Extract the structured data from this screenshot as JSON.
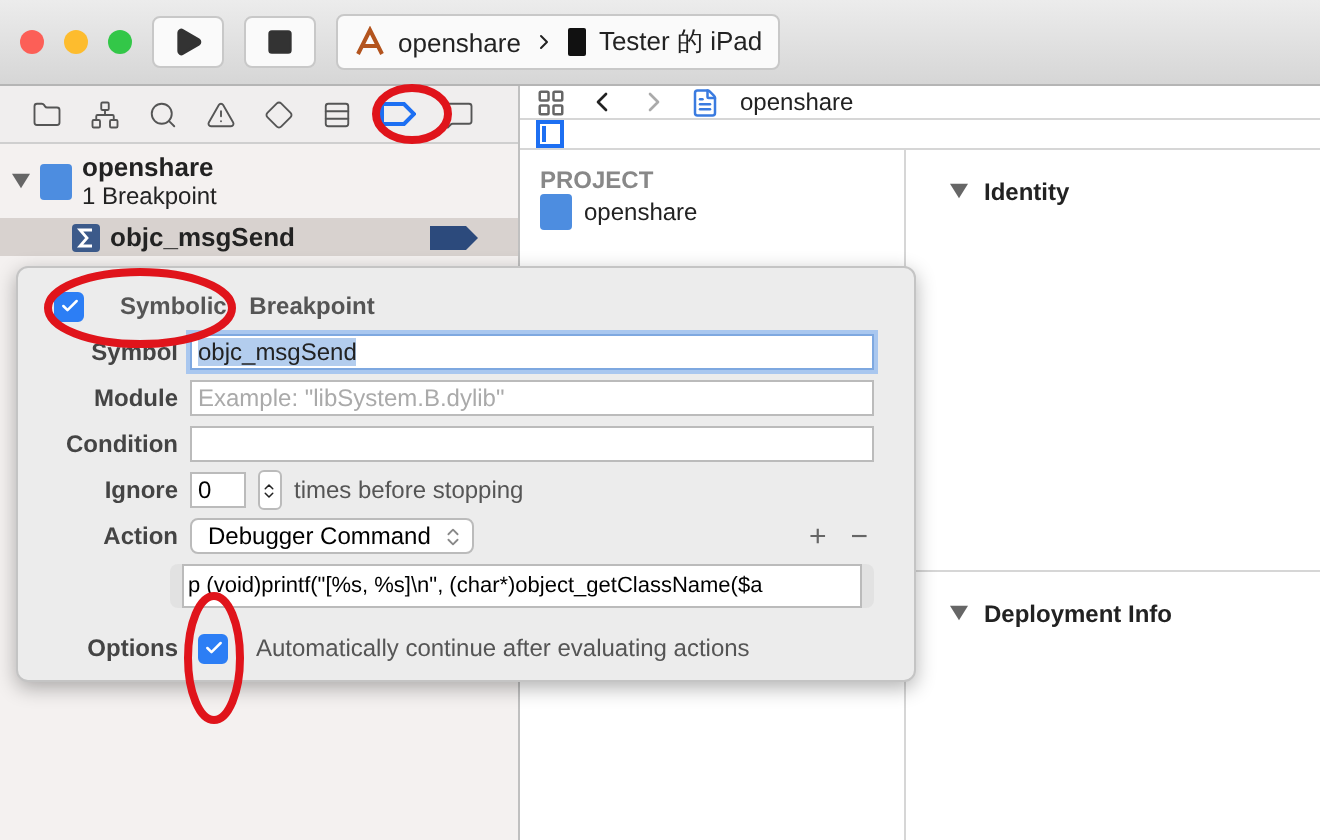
{
  "toolbar": {
    "project": "openshare",
    "device": "Tester 的 iPad"
  },
  "navigator_tabs": [
    {
      "kind": "folder",
      "selected": false
    },
    {
      "kind": "hierarchy",
      "selected": false
    },
    {
      "kind": "search",
      "selected": false
    },
    {
      "kind": "warning",
      "selected": false
    },
    {
      "kind": "test",
      "selected": false
    },
    {
      "kind": "debug",
      "selected": false
    },
    {
      "kind": "breakpoint",
      "selected": true
    },
    {
      "kind": "report",
      "selected": false
    }
  ],
  "tree": {
    "name": "openshare",
    "subtitle": "1 Breakpoint",
    "expanded": true,
    "children": [
      {
        "name": "objc_msgSend",
        "selected": true,
        "enabled": true
      }
    ]
  },
  "jump_bar": {
    "crumb": "openshare"
  },
  "project_list": {
    "heading": "PROJECT",
    "items": [
      "openshare"
    ]
  },
  "inspector": [
    {
      "title": "Identity",
      "expanded": true
    },
    {
      "title": "Deployment Info",
      "expanded": true
    }
  ],
  "popover": {
    "enabled": true,
    "title": "Symbolic Breakpoint",
    "fields": [
      {
        "label": "Symbol",
        "value": "objc_msgSend",
        "focused": true
      },
      {
        "label": "Module",
        "placeholder": "Example: \"libSystem.B.dylib\"",
        "focused": false
      },
      {
        "label": "Condition",
        "focused": false
      }
    ],
    "ignore": {
      "label": "Ignore",
      "value": "0",
      "suffix": "times before stopping"
    },
    "action": {
      "label": "Action",
      "value": "Debugger Command",
      "add": "+",
      "remove": "−",
      "command": "p (void)printf(\"[%s, %s]\\n\", (char*)object_getClassName($a"
    },
    "options": {
      "label": "Options",
      "checked": true,
      "text": "Automatically continue after evaluating actions"
    }
  }
}
